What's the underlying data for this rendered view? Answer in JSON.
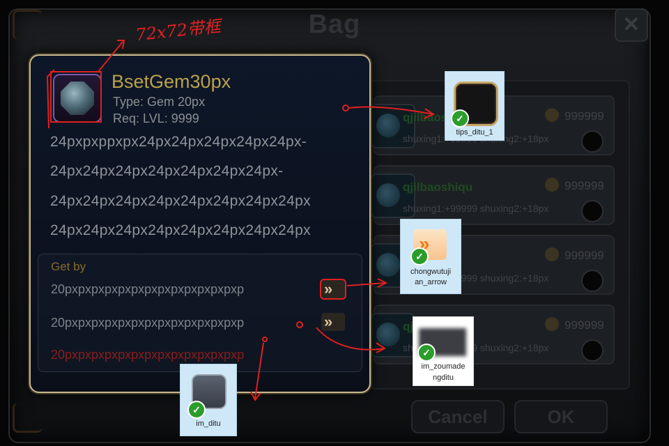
{
  "bag": {
    "title": "Bag",
    "close_icon": "✕",
    "items": [
      {
        "name": "qjilbaoshi",
        "attrs": "shuxing1:+99999  shuxing2:+18px",
        "price": "999999"
      },
      {
        "name": "qjilbaoshiqu",
        "attrs": "shuxing1:+99999  shuxing2:+18px",
        "price": "999999"
      },
      {
        "name": "qjilbaoshi",
        "attrs": "shuxing1:+99999  shuxing2:+18px",
        "price": "999999"
      },
      {
        "name": "qjilbaoshi",
        "attrs": "shuxing1:+99999  shuxing2:+18px",
        "price": "999999"
      }
    ],
    "cancel_label": "Cancel",
    "ok_label": "OK"
  },
  "tooltip": {
    "name": "BsetGem30px",
    "type_line": "Type: Gem 20px",
    "req_line": "Req: LVL: 9999",
    "description": [
      "24pxpxppxpx24px24px24px24px24px-",
      "24px24px24px24px24px24px24px-",
      "24px24px24px24px24px24px24px24px",
      "24px24px24px24px24px24px24px24px"
    ],
    "get_by": {
      "title": "Get by",
      "sources": [
        {
          "text": "20pxpxpxpxpxpxpxpxpxpxpxpxpxp",
          "color": "#7e848a"
        },
        {
          "text": "20pxpxpxpxpxpxpxpxpxpxpxpxpxp",
          "color": "#7e848a"
        },
        {
          "text": "20pxpxpxpxpxpxpxpxpxpxpxpxpxp",
          "color": "#8c1d1d"
        }
      ],
      "arrow_glyph": "»"
    }
  },
  "annotations": {
    "size_note": "72x72带框",
    "tips_ditu_label": "tips_ditu_1",
    "arrow_label_1": "chongwutuji",
    "arrow_label_2": "an_arrow",
    "zoumade_label_1": "im_zoumade",
    "zoumade_label_2": "ngditu",
    "ditu_label": "im_ditu",
    "check_glyph": "✓",
    "arrow_icon_glyph": "»"
  },
  "colors": {
    "tooltip_border": "#c9b98e",
    "gem_name": "#bba04a",
    "annotation_red": "#e02020",
    "annotation_card": "#cfe8f8",
    "check_green": "#2a9d2a"
  }
}
